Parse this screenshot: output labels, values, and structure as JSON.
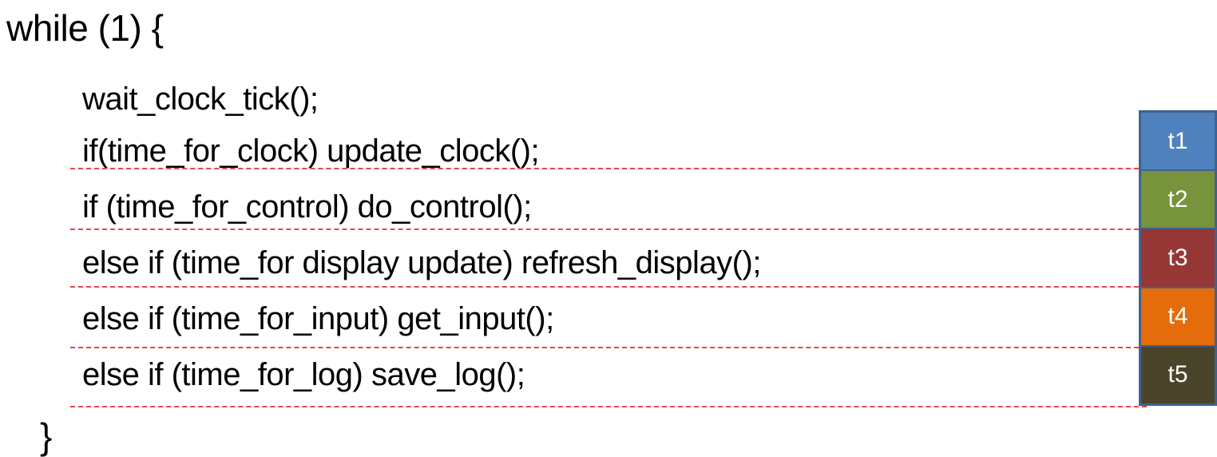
{
  "code": {
    "opening": "while (1) {",
    "lines": [
      "wait_clock_tick();",
      "if(time_for_clock) update_clock();",
      "if (time_for_control) do_control();",
      "else if (time_for display update) refresh_display();",
      "else if (time_for_input) get_input();",
      "else if (time_for_log) save_log();"
    ],
    "closing": "}"
  },
  "slots": [
    {
      "label": "t1",
      "color": "#4f81bd"
    },
    {
      "label": "t2",
      "color": "#77933c"
    },
    {
      "label": "t3",
      "color": "#953735"
    },
    {
      "label": "t4",
      "color": "#e46c0a"
    },
    {
      "label": "t5",
      "color": "#4a452a"
    }
  ],
  "colors": {
    "dashed_separator": "#e8454a",
    "slot_border": "#41628f"
  }
}
